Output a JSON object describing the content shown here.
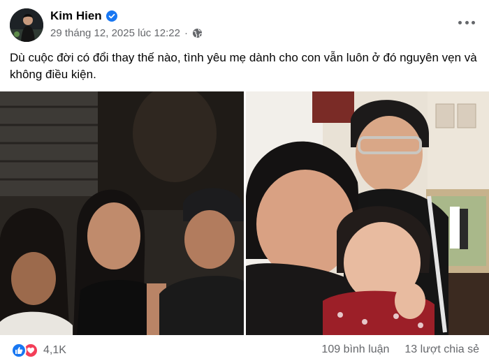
{
  "post": {
    "author": "Kim Hien",
    "timestamp": "29 tháng 12, 2025 lúc 12:22",
    "separator": "·",
    "privacy_icon": "globe-icon",
    "verified_icon": "verified-badge-icon",
    "caption": "Dù cuộc đời có đổi thay thế nào, tình yêu mẹ dành cho con vẫn luôn ở đó nguyên vẹn và không điều kiện.",
    "photos": [
      {
        "icon": "photo-mother-with-two-children"
      },
      {
        "icon": "photo-mother-with-son-and-daughter"
      }
    ]
  },
  "footer": {
    "reaction_icons": [
      "like-icon",
      "love-icon"
    ],
    "reaction_count": "4,1K",
    "comments": "109 bình luận",
    "shares": "13 lượt chia sẻ"
  },
  "colors": {
    "accent": "#1877f2",
    "love": "#f33e58",
    "secondary_text": "#65676b",
    "primary_text": "#050505"
  }
}
